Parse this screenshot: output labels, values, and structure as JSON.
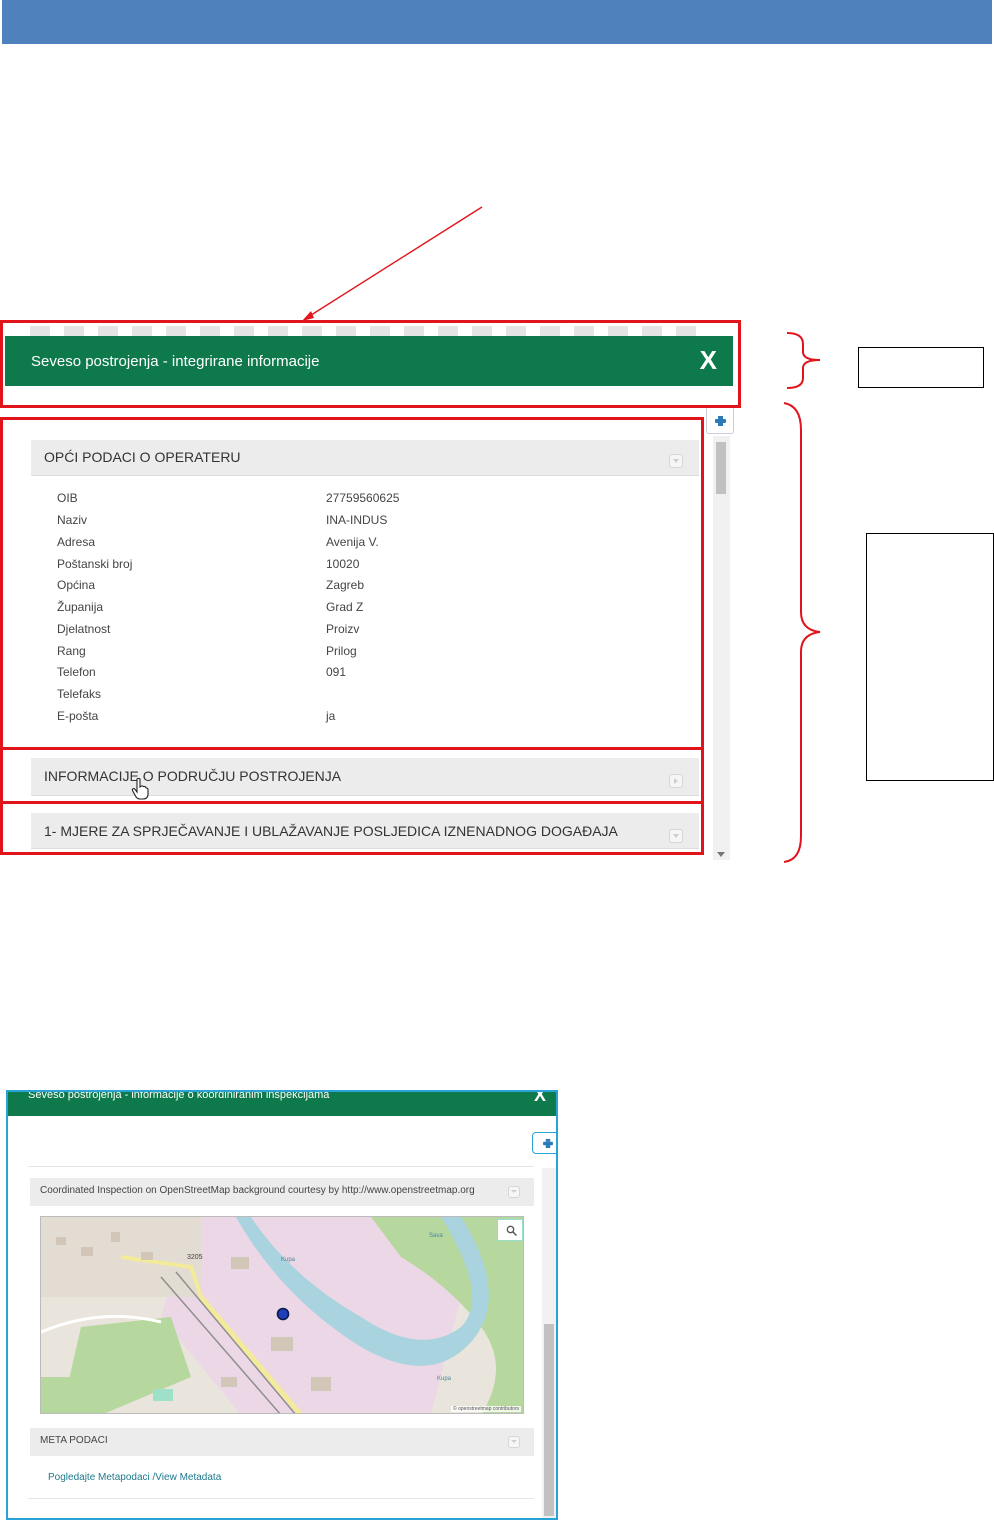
{
  "colors": {
    "top_bar": "#4f81bd",
    "dialog_header": "#0e7a4b",
    "annotation_red": "#e2141b",
    "dialog2_border": "#29a3d6",
    "link": "#1f7a8c"
  },
  "dialog1": {
    "title": "Seveso postrojenja - integrirane informacije",
    "close_label": "X",
    "print_icon": "printer-icon",
    "sections": [
      {
        "label": "OPĆI PODACI O OPERATERU",
        "icon": "collapse-toggle-icon"
      },
      {
        "label": "INFORMACIJE O PODRUČJU POSTROJENJA",
        "icon": "expand-toggle-icon"
      },
      {
        "label": "1- MJERE ZA SPRJEČAVANJE I UBLAŽAVANJE POSLJEDICA IZNENADNOG DOGAĐAJA",
        "icon": "collapse-toggle-icon"
      }
    ],
    "operator_fields": [
      {
        "label": "OIB",
        "value": "27759560625"
      },
      {
        "label": "Naziv",
        "value": "INA-INDUS"
      },
      {
        "label": "Adresa",
        "value": "Avenija V."
      },
      {
        "label": "Poštanski broj",
        "value": "10020"
      },
      {
        "label": "Općina",
        "value": "Zagreb"
      },
      {
        "label": "Županija",
        "value": "Grad Z"
      },
      {
        "label": "Djelatnost",
        "value": "Proizv"
      },
      {
        "label": "Rang",
        "value": "Prilog"
      },
      {
        "label": "Telefon",
        "value": "091"
      },
      {
        "label": "Telefaks",
        "value": ""
      },
      {
        "label": "E-pošta",
        "value": "ja"
      }
    ]
  },
  "dialog2": {
    "title": "Seveso postrojenja - informacije o koordiniranim inspekcijama",
    "close_label": "X",
    "map_section_label": "Coordinated Inspection on OpenStreetMap background courtesy by http://www.openstreetmap.org",
    "map": {
      "road_label": "3205",
      "river_labels": [
        "Kupa",
        "Kupa",
        "Sava"
      ],
      "attribution": "© openstreetmap contributors",
      "zoom_icon": "magnifier-icon"
    },
    "meta_section_label": "META PODACI",
    "meta_link": "Pogledajte Metapodaci /View Metadata"
  }
}
